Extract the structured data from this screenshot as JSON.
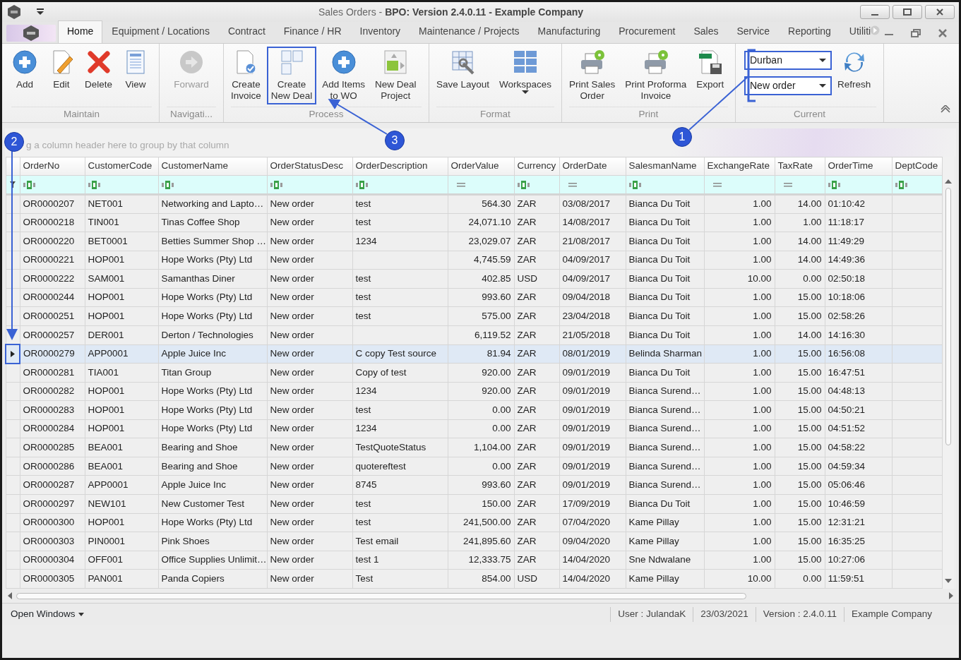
{
  "window": {
    "title": "Sales Orders - **BPO: Version 2.4.0.11 - Example Company**"
  },
  "tabs": [
    {
      "label": "Home",
      "selected": true
    },
    {
      "label": "Equipment / Locations",
      "selected": false
    },
    {
      "label": "Contract",
      "selected": false
    },
    {
      "label": "Finance / HR",
      "selected": false
    },
    {
      "label": "Inventory",
      "selected": false
    },
    {
      "label": "Maintenance / Projects",
      "selected": false
    },
    {
      "label": "Manufacturing",
      "selected": false
    },
    {
      "label": "Procurement",
      "selected": false
    },
    {
      "label": "Sales",
      "selected": false
    },
    {
      "label": "Service",
      "selected": false
    },
    {
      "label": "Reporting",
      "selected": false
    },
    {
      "label": "Utiliti",
      "selected": false
    }
  ],
  "ribbon": [
    {
      "label": "Maintain",
      "buttons": [
        {
          "label": "Add",
          "disabled": false,
          "highlighted": false
        },
        {
          "label": "Edit",
          "disabled": false,
          "highlighted": false
        },
        {
          "label": "Delete",
          "disabled": false,
          "highlighted": false
        },
        {
          "label": "View",
          "disabled": false,
          "highlighted": false
        }
      ]
    },
    {
      "label": "Navigati...",
      "buttons": [
        {
          "label": "Forward",
          "disabled": true,
          "highlighted": false
        }
      ]
    },
    {
      "label": "Process",
      "buttons": [
        {
          "label": "Create\nInvoice",
          "disabled": false,
          "highlighted": false
        },
        {
          "label": "Create\nNew Deal",
          "disabled": false,
          "highlighted": true
        },
        {
          "label": "Add Items\nto WO",
          "disabled": false,
          "highlighted": false
        },
        {
          "label": "New Deal\nProject",
          "disabled": false,
          "highlighted": false
        }
      ]
    },
    {
      "label": "Format",
      "buttons": [
        {
          "label": "Save Layout",
          "disabled": false,
          "highlighted": false
        },
        {
          "label": "Workspaces",
          "disabled": false,
          "highlighted": false,
          "dropdown": true
        }
      ]
    },
    {
      "label": "Print",
      "buttons": [
        {
          "label": "Print Sales\nOrder",
          "disabled": false,
          "highlighted": false
        },
        {
          "label": "Print Proforma\nInvoice",
          "disabled": false,
          "highlighted": false
        },
        {
          "label": "Export",
          "disabled": false,
          "highlighted": false
        }
      ]
    },
    {
      "label": "Current",
      "combos": [
        {
          "value": "Durban",
          "highlighted": true
        },
        {
          "value": "New order",
          "highlighted": true
        }
      ],
      "buttons": [
        {
          "label": "Refresh",
          "disabled": false,
          "highlighted": false
        }
      ]
    }
  ],
  "group_panel": {
    "text": "g a column header here to group by that column"
  },
  "table": {
    "columns": [
      {
        "label": "OrderNo",
        "numeric": false,
        "kind": "text"
      },
      {
        "label": "CustomerCode",
        "numeric": false,
        "kind": "text"
      },
      {
        "label": "CustomerName",
        "numeric": false,
        "kind": "text"
      },
      {
        "label": "OrderStatusDesc",
        "numeric": false,
        "kind": "text"
      },
      {
        "label": "OrderDescription",
        "numeric": false,
        "kind": "text"
      },
      {
        "label": "OrderValue",
        "numeric": true,
        "kind": "equals"
      },
      {
        "label": "Currency",
        "numeric": false,
        "kind": "text"
      },
      {
        "label": "OrderDate",
        "numeric": false,
        "kind": "equals"
      },
      {
        "label": "SalesmanName",
        "numeric": false,
        "kind": "text"
      },
      {
        "label": "ExchangeRate",
        "numeric": true,
        "kind": "equals"
      },
      {
        "label": "TaxRate",
        "numeric": true,
        "kind": "equals"
      },
      {
        "label": "OrderTime",
        "numeric": false,
        "kind": "text"
      },
      {
        "label": "DeptCode",
        "kind": "text"
      }
    ],
    "rows": [
      {
        "selected": false,
        "highlighted": false,
        "cells": [
          "OR0000207",
          "NET001",
          "Networking and Lapto…",
          "New order",
          "test",
          "564.30",
          "ZAR",
          "03/08/2017",
          "Bianca Du Toit",
          "1.00",
          "14.00",
          "01:10:42",
          null
        ]
      },
      {
        "selected": false,
        "highlighted": false,
        "cells": [
          "OR0000218",
          "TIN001",
          "Tinas Coffee Shop",
          "New order",
          "test",
          "24,071.10",
          "ZAR",
          "14/08/2017",
          "Bianca Du Toit",
          "1.00",
          "1.00",
          "11:18:17",
          null
        ]
      },
      {
        "selected": false,
        "highlighted": false,
        "cells": [
          "OR0000220",
          "BET0001",
          "Betties Summer Shop …",
          "New order",
          "1234",
          "23,029.07",
          "ZAR",
          "21/08/2017",
          "Bianca Du Toit",
          "1.00",
          "14.00",
          "11:49:29",
          null
        ]
      },
      {
        "selected": false,
        "highlighted": false,
        "cells": [
          "OR0000221",
          "HOP001",
          "Hope Works (Pty) Ltd",
          "New order",
          null,
          "4,745.59",
          "ZAR",
          "04/09/2017",
          "Bianca Du Toit",
          "1.00",
          "14.00",
          "14:49:36",
          null
        ]
      },
      {
        "selected": false,
        "highlighted": false,
        "cells": [
          "OR0000222",
          "SAM001",
          "Samanthas Diner",
          "New order",
          "test",
          "402.85",
          "USD",
          "04/09/2017",
          "Bianca Du Toit",
          "10.00",
          "0.00",
          "02:50:18",
          null
        ]
      },
      {
        "selected": false,
        "highlighted": false,
        "cells": [
          "OR0000244",
          "HOP001",
          "Hope Works (Pty) Ltd",
          "New order",
          "test",
          "993.60",
          "ZAR",
          "09/04/2018",
          "Bianca Du Toit",
          "1.00",
          "15.00",
          "10:18:06",
          null
        ]
      },
      {
        "selected": false,
        "highlighted": false,
        "cells": [
          "OR0000251",
          "HOP001",
          "Hope Works (Pty) Ltd",
          "New order",
          "test",
          "575.00",
          "ZAR",
          "23/04/2018",
          "Bianca Du Toit",
          "1.00",
          "15.00",
          "02:58:26",
          null
        ]
      },
      {
        "selected": false,
        "highlighted": false,
        "cells": [
          "OR0000257",
          "DER001",
          "Derton / Technologies",
          "New order",
          null,
          "6,119.52",
          "ZAR",
          "21/05/2018",
          "Bianca Du Toit",
          "1.00",
          "14.00",
          "14:16:30",
          null
        ]
      },
      {
        "selected": true,
        "highlighted": true,
        "cells": [
          "OR0000279",
          "APP0001",
          "Apple Juice Inc",
          "New order",
          "C copy Test source",
          "81.94",
          "ZAR",
          "08/01/2019",
          "Belinda Sharman",
          "1.00",
          "15.00",
          "16:56:08",
          null
        ]
      },
      {
        "selected": false,
        "highlighted": false,
        "cells": [
          "OR0000281",
          "TIA001",
          "Titan Group",
          "New order",
          "Copy of test",
          "920.00",
          "ZAR",
          "09/01/2019",
          "Bianca Du Toit",
          "1.00",
          "15.00",
          "16:47:51",
          null
        ]
      },
      {
        "selected": false,
        "highlighted": false,
        "cells": [
          "OR0000282",
          "HOP001",
          "Hope Works (Pty) Ltd",
          "New order",
          "1234",
          "920.00",
          "ZAR",
          "09/01/2019",
          "Bianca Surend…",
          "1.00",
          "15.00",
          "04:48:13",
          null
        ]
      },
      {
        "selected": false,
        "highlighted": false,
        "cells": [
          "OR0000283",
          "HOP001",
          "Hope Works (Pty) Ltd",
          "New order",
          "test",
          "0.00",
          "ZAR",
          "09/01/2019",
          "Bianca Surend…",
          "1.00",
          "15.00",
          "04:50:21",
          null
        ]
      },
      {
        "selected": false,
        "highlighted": false,
        "cells": [
          "OR0000284",
          "HOP001",
          "Hope Works (Pty) Ltd",
          "New order",
          "1234",
          "0.00",
          "ZAR",
          "09/01/2019",
          "Bianca Surend…",
          "1.00",
          "15.00",
          "04:51:52",
          null
        ]
      },
      {
        "selected": false,
        "highlighted": false,
        "cells": [
          "OR0000285",
          "BEA001",
          "Bearing and Shoe",
          "New order",
          "TestQuoteStatus",
          "1,104.00",
          "ZAR",
          "09/01/2019",
          "Bianca Surend…",
          "1.00",
          "15.00",
          "04:58:22",
          null
        ]
      },
      {
        "selected": false,
        "highlighted": false,
        "cells": [
          "OR0000286",
          "BEA001",
          "Bearing and Shoe",
          "New order",
          "quotereftest",
          "0.00",
          "ZAR",
          "09/01/2019",
          "Bianca Surend…",
          "1.00",
          "15.00",
          "04:59:34",
          null
        ]
      },
      {
        "selected": false,
        "highlighted": false,
        "cells": [
          "OR0000287",
          "APP0001",
          "Apple Juice Inc",
          "New order",
          "8745",
          "993.60",
          "ZAR",
          "09/01/2019",
          "Bianca Surend…",
          "1.00",
          "15.00",
          "05:06:46",
          null
        ]
      },
      {
        "selected": false,
        "highlighted": false,
        "cells": [
          "OR0000297",
          "NEW101",
          "New Customer Test",
          "New order",
          "test",
          "150.00",
          "ZAR",
          "17/09/2019",
          "Bianca Du Toit",
          "1.00",
          "15.00",
          "10:46:59",
          null
        ]
      },
      {
        "selected": false,
        "highlighted": false,
        "cells": [
          "OR0000300",
          "HOP001",
          "Hope Works (Pty) Ltd",
          "New order",
          "test",
          "241,500.00",
          "ZAR",
          "07/04/2020",
          "Kame Pillay",
          "1.00",
          "15.00",
          "12:31:21",
          null
        ]
      },
      {
        "selected": false,
        "highlighted": false,
        "cells": [
          "OR0000303",
          "PIN0001",
          "Pink Shoes",
          "New order",
          "Test email",
          "241,895.60",
          "ZAR",
          "09/04/2020",
          "Kame Pillay",
          "1.00",
          "15.00",
          "16:35:25",
          null
        ]
      },
      {
        "selected": false,
        "highlighted": false,
        "cells": [
          "OR0000304",
          "OFF001",
          "Office Supplies Unlimit…",
          "New order",
          "test 1",
          "12,333.75",
          "ZAR",
          "14/04/2020",
          "Sne Ndwalane",
          "1.00",
          "15.00",
          "10:27:06",
          null
        ]
      },
      {
        "selected": false,
        "highlighted": false,
        "cells": [
          "OR0000305",
          "PAN001",
          "Panda Copiers",
          "New order",
          "Test",
          "854.00",
          "USD",
          "14/04/2020",
          "Kame Pillay",
          "10.00",
          "0.00",
          "11:59:51",
          null
        ]
      }
    ]
  },
  "status_bar": {
    "menu": "Open Windows",
    "items": [
      "User : JulandaK",
      "23/03/2021",
      "Version : 2.4.0.11",
      "Example Company"
    ]
  },
  "annotations": [
    {
      "number": "1"
    },
    {
      "number": "2"
    },
    {
      "number": "3"
    }
  ]
}
